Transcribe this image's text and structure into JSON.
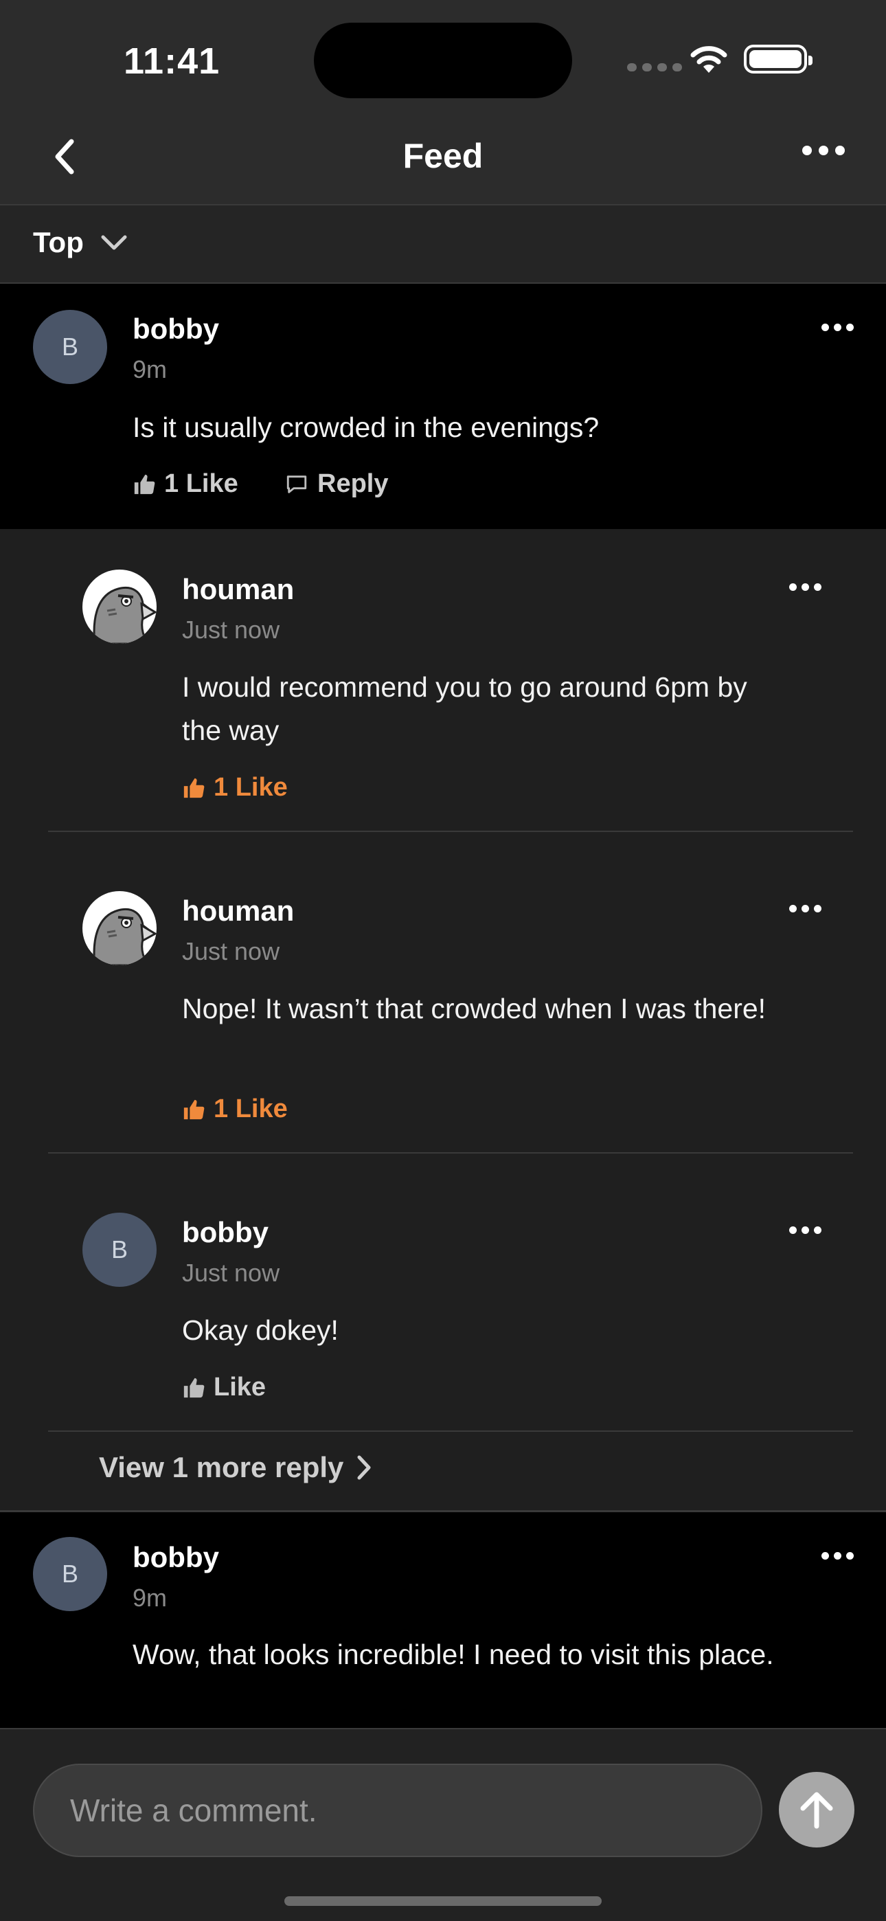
{
  "status_bar": {
    "time": "11:41"
  },
  "nav": {
    "title": "Feed"
  },
  "sort": {
    "label": "Top"
  },
  "comments": [
    {
      "avatar_initial": "B",
      "username": "bobby",
      "time": "9m",
      "text": "Is it usually crowded in the evenings?",
      "like_label": "1 Like",
      "reply_label": "Reply"
    },
    {
      "avatar_initial": "B",
      "username": "bobby",
      "time": "9m",
      "text": "Wow, that looks incredible! I need to visit this place."
    }
  ],
  "replies": [
    {
      "username": "houman",
      "time": "Just now",
      "text": "I would recommend you to go around 6pm by the way",
      "like_label": "1 Like",
      "liked": true
    },
    {
      "username": "houman",
      "time": "Just now",
      "text": "Nope! It wasn’t that crowded when I was there!",
      "like_label": "1 Like",
      "liked": true
    },
    {
      "avatar_initial": "B",
      "username": "bobby",
      "time": "Just now",
      "text": "Okay dokey!",
      "like_label": "Like",
      "liked": false
    }
  ],
  "view_more_label": "View 1 more reply",
  "composer": {
    "placeholder": "Write a comment."
  },
  "colors": {
    "accent": "#f08a3c",
    "avatar_bg": "#4a5568",
    "background": "#000000",
    "thread_bg": "#1f1f1f"
  }
}
